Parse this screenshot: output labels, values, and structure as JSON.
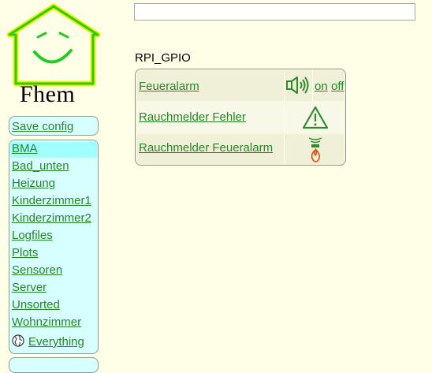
{
  "logo": {
    "text": "Fhem",
    "colors": {
      "roof": "#22CC22",
      "outline": "#DDDD00"
    }
  },
  "search": {
    "value": "",
    "placeholder": ""
  },
  "menu": {
    "save_config": "Save config",
    "rooms": [
      {
        "label": "BMA",
        "selected": true
      },
      {
        "label": "Bad_unten"
      },
      {
        "label": "Heizung"
      },
      {
        "label": "Kinderzimmer1"
      },
      {
        "label": "Kinderzimmer2"
      },
      {
        "label": "Logfiles"
      },
      {
        "label": "Plots"
      },
      {
        "label": "Sensoren"
      },
      {
        "label": "Server"
      },
      {
        "label": "Unsorted"
      },
      {
        "label": "Wohnzimmer"
      },
      {
        "label": "Everything",
        "icon": "globe-icon"
      }
    ]
  },
  "main": {
    "group_title": "RPI_GPIO",
    "devices": [
      {
        "name": "Feueralarm",
        "icon": "speaker-icon",
        "set_on": "on",
        "set_off": "off"
      },
      {
        "name": "Rauchmelder Fehler",
        "icon": "warning-triangle-icon"
      },
      {
        "name": "Rauchmelder Feueralarm",
        "icon": "smoke-fire-icon"
      }
    ]
  },
  "colors": {
    "background": "#FFFFE7",
    "link": "#278727",
    "menu_bg": "#D7FFFF",
    "menu_selected": "#A2FFFF"
  }
}
